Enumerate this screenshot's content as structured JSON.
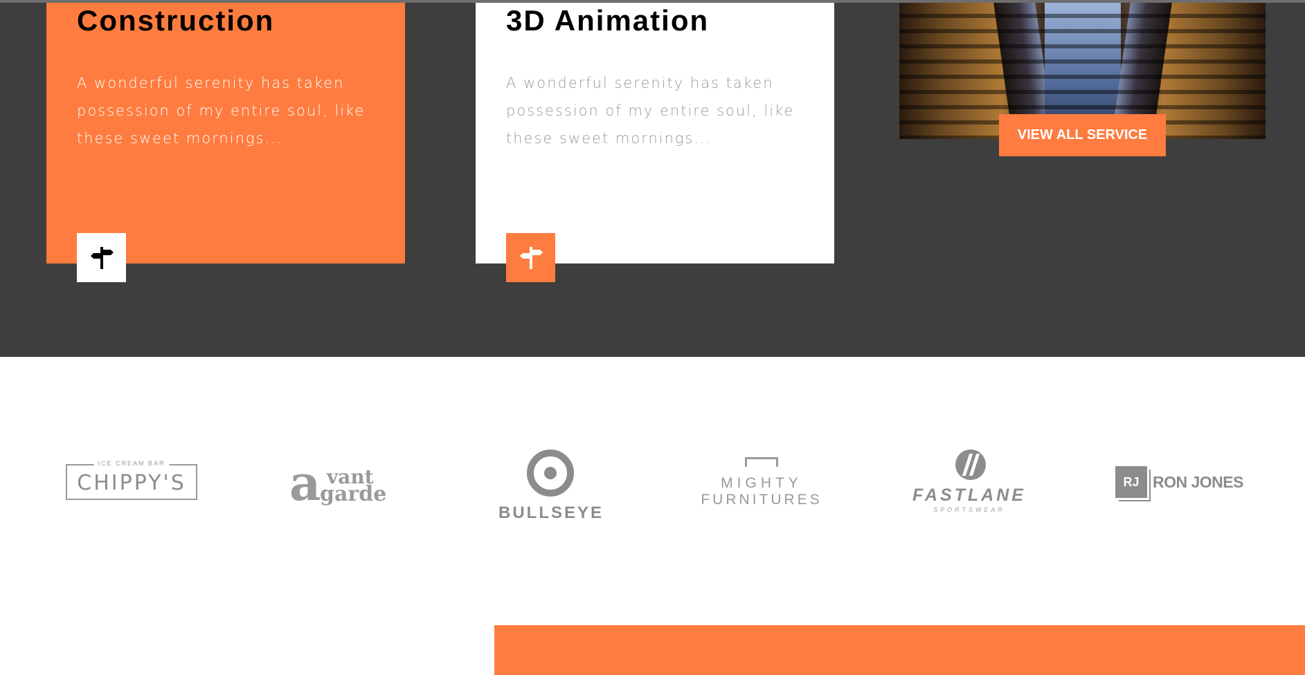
{
  "services": {
    "cards": [
      {
        "title": "Construction",
        "text": "A wonderful serenity has taken possession of my entire soul, like these sweet mornings...",
        "icon": "signpost-icon"
      },
      {
        "title": "3D Animation",
        "text": "A wonderful serenity has taken possession of my entire soul, like these sweet mornings...",
        "icon": "signpost-icon"
      }
    ],
    "view_all_label": "VIEW ALL SERVICE"
  },
  "logos": [
    {
      "name": "chippys-logo",
      "top_text": "ICE CREAM BAR",
      "main_text": "CHIPPY'S"
    },
    {
      "name": "avant-garde-logo",
      "mark": "a",
      "line1": "vant",
      "line2": "garde"
    },
    {
      "name": "bullseye-logo",
      "text": "BULLSEYE"
    },
    {
      "name": "mighty-furnitures-logo",
      "line1": "MIGHTY",
      "line2": "FURNITURES"
    },
    {
      "name": "fastlane-logo",
      "line1": "FASTLANE",
      "line2": "SPORTSWEAR"
    },
    {
      "name": "ron-jones-logo",
      "mark": "RJ",
      "text": "RON JONES"
    }
  ],
  "colors": {
    "accent": "#fe7c3f",
    "dark_bg": "#3e3e3e",
    "logo_gray": "#8c8c8c"
  }
}
